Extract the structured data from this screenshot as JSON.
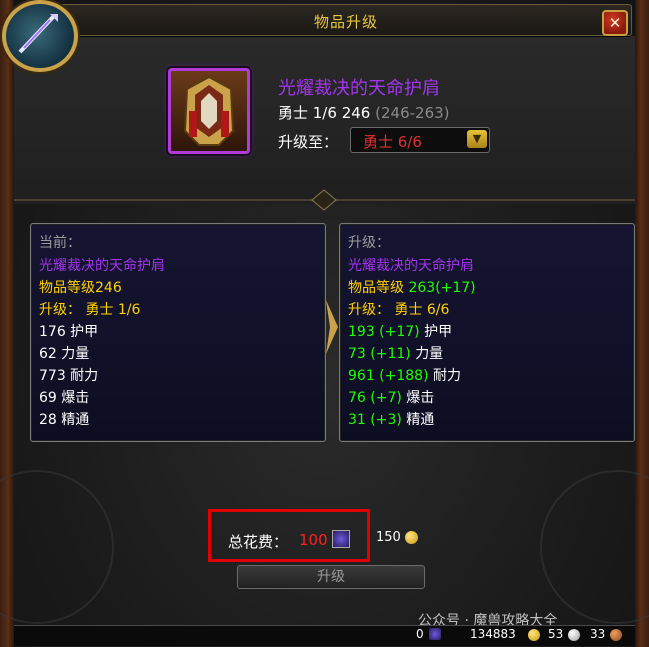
{
  "window": {
    "title": "物品升级",
    "close_label": "✕"
  },
  "item": {
    "name": "光耀裁决的天命护肩",
    "track": "勇士 1/6",
    "item_level": "246",
    "range": "(246-263)",
    "upgrade_to_label": "升级至：",
    "upgrade_to_value": "勇士 6/6"
  },
  "current": {
    "header": "当前：",
    "name": "光耀裁决的天命护肩",
    "item_level": "物品等级246",
    "upgrade": "升级：",
    "upgrade_value": "勇士 1/6",
    "stats": [
      "176 护甲",
      "62 力量",
      "773 耐力",
      "69 爆击",
      "28 精通"
    ]
  },
  "upgraded": {
    "header": "升级：",
    "name": "光耀裁决的天命护肩",
    "item_level_label": "物品等级",
    "item_level_value": "263(+17)",
    "upgrade": "升级：",
    "upgrade_value": "勇士 6/6",
    "stats": [
      {
        "value": "193 (+17)",
        "name": "护甲"
      },
      {
        "value": "73 (+11)",
        "name": "力量"
      },
      {
        "value": "961 (+188)",
        "name": "耐力"
      },
      {
        "value": "76 (+7)",
        "name": "爆击"
      },
      {
        "value": "31 (+3)",
        "name": "精通"
      }
    ]
  },
  "cost": {
    "label": "总花费：",
    "value": "100",
    "gold": "150"
  },
  "upgrade_button": "升级",
  "bottom_bar": {
    "crests": "0",
    "gold": "134883",
    "silver": "53",
    "copper": "33"
  },
  "watermark": "公众号 · 魔兽攻略大全",
  "colors": {
    "epic": "#a335ee",
    "gold_text": "#ffd100",
    "green": "#1eff00",
    "red": "#ff2020"
  }
}
